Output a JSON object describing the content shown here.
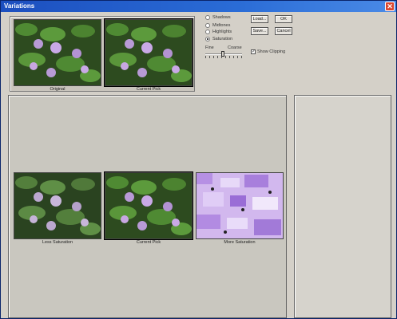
{
  "window": {
    "title": "Variations",
    "close_glyph": "✕"
  },
  "top_thumbnails": [
    {
      "caption": "Original"
    },
    {
      "caption": "Current Pick"
    }
  ],
  "tone_options": [
    {
      "label": "Shadows",
      "selected": false
    },
    {
      "label": "Midtones",
      "selected": false
    },
    {
      "label": "Highlights",
      "selected": false
    },
    {
      "label": "Saturation",
      "selected": true
    }
  ],
  "buttons": {
    "load": "Load...",
    "ok": "OK",
    "save": "Save...",
    "cancel": "Cancel"
  },
  "slider": {
    "left_label": "Fine",
    "right_label": "Coarse",
    "level": 0.45
  },
  "show_clipping": {
    "label": "Show Clipping",
    "checked": true
  },
  "variations": [
    {
      "caption": "Less Saturation"
    },
    {
      "caption": "Current Pick"
    },
    {
      "caption": "More Saturation"
    }
  ],
  "colors": {
    "titlebar": "#2a6cd6",
    "face": "#d4d0c8",
    "close": "#d9462f"
  }
}
